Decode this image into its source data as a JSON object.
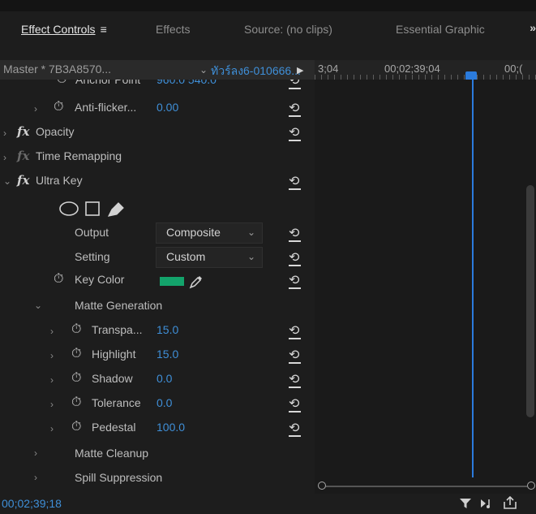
{
  "tabs": {
    "effect_controls": "Effect Controls",
    "effect_controls_menu": "≡",
    "effects": "Effects",
    "source": "Source: (no clips)",
    "essential_graphics": "Essential Graphic",
    "more": "»"
  },
  "header": {
    "master": "Master * 7B3A8570...",
    "clip": "ทัวร์ลง6-010666...",
    "timecode_a": "3;04",
    "timecode_b": "00;02;39;04",
    "timecode_c": "00;("
  },
  "rows": {
    "anchor_label": "Anchor Point",
    "anchor_value": "960.0   540.0",
    "antiflicker_label": "Anti-flicker...",
    "antiflicker_value": "0.00",
    "opacity_label": "Opacity",
    "time_remap_label": "Time Remapping",
    "ultra_key_label": "Ultra Key",
    "output_label": "Output",
    "output_value": "Composite",
    "setting_label": "Setting",
    "setting_value": "Custom",
    "key_color_label": "Key Color",
    "key_color_hex": "#13a36b",
    "matte_gen_label": "Matte Generation",
    "transparency_label": "Transpa...",
    "transparency_value": "15.0",
    "highlight_label": "Highlight",
    "highlight_value": "15.0",
    "shadow_label": "Shadow",
    "shadow_value": "0.0",
    "tolerance_label": "Tolerance",
    "tolerance_value": "0.0",
    "pedestal_label": "Pedestal",
    "pedestal_value": "100.0",
    "matte_cleanup_label": "Matte Cleanup",
    "spill_label": "Spill Suppression"
  },
  "footer": {
    "timecode": "00;02;39;18"
  },
  "colors": {
    "accent": "#2b7bdc",
    "value_blue": "#3f8fd8",
    "key_green": "#13a36b"
  }
}
